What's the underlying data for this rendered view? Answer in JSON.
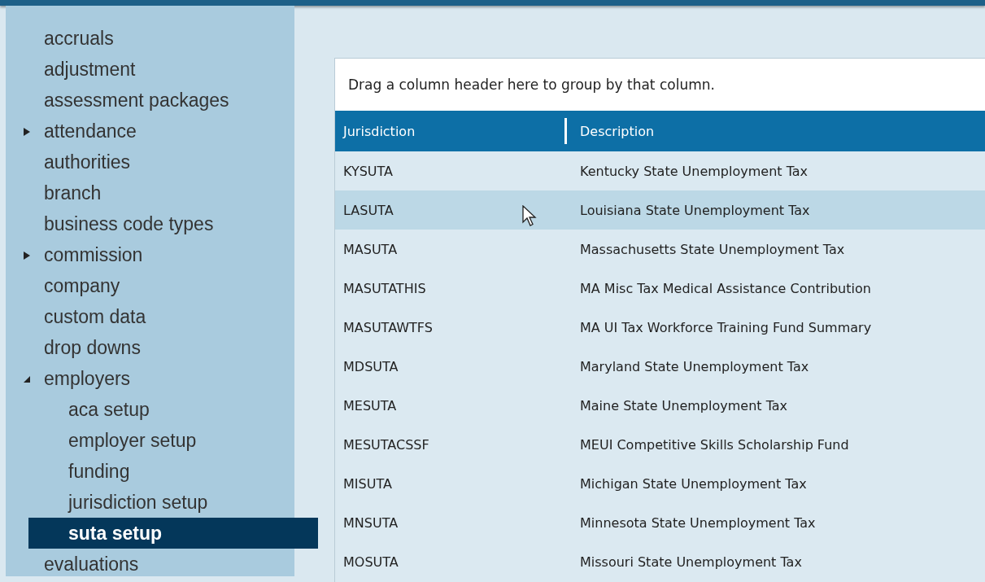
{
  "sidebar": {
    "items": [
      {
        "label": "accruals",
        "kind": "leaf",
        "selected": false
      },
      {
        "label": "adjustment",
        "kind": "leaf",
        "selected": false
      },
      {
        "label": "assessment packages",
        "kind": "leaf",
        "selected": false
      },
      {
        "label": "attendance",
        "kind": "group",
        "expanded": false,
        "selected": false
      },
      {
        "label": "authorities",
        "kind": "leaf",
        "selected": false
      },
      {
        "label": "branch",
        "kind": "leaf",
        "selected": false
      },
      {
        "label": "business code types",
        "kind": "leaf",
        "selected": false
      },
      {
        "label": "commission",
        "kind": "group",
        "expanded": false,
        "selected": false
      },
      {
        "label": "company",
        "kind": "leaf",
        "selected": false
      },
      {
        "label": "custom data",
        "kind": "leaf",
        "selected": false
      },
      {
        "label": "drop downs",
        "kind": "leaf",
        "selected": false
      },
      {
        "label": "employers",
        "kind": "group",
        "expanded": true,
        "selected": false,
        "children": [
          {
            "label": "aca setup",
            "kind": "leaf",
            "selected": false
          },
          {
            "label": "employer setup",
            "kind": "leaf",
            "selected": false
          },
          {
            "label": "funding",
            "kind": "leaf",
            "selected": false
          },
          {
            "label": "jurisdiction setup",
            "kind": "leaf",
            "selected": false
          },
          {
            "label": "suta setup",
            "kind": "leaf",
            "selected": true
          }
        ]
      },
      {
        "label": "evaluations",
        "kind": "leaf",
        "selected": false
      }
    ]
  },
  "grid": {
    "group_panel": "Drag a column header here to group by that column.",
    "columns": [
      "Jurisdiction",
      "Description"
    ],
    "rows": [
      {
        "cells": [
          "KYSUTA",
          "Kentucky State Unemployment Tax"
        ],
        "hovered": false
      },
      {
        "cells": [
          "LASUTA",
          "Louisiana State Unemployment Tax"
        ],
        "hovered": true
      },
      {
        "cells": [
          "MASUTA",
          "Massachusetts State Unemployment Tax"
        ],
        "hovered": false
      },
      {
        "cells": [
          "MASUTATHIS",
          "MA Misc Tax Medical Assistance Contribution"
        ],
        "hovered": false
      },
      {
        "cells": [
          "MASUTAWTFS",
          "MA UI Tax Workforce Training Fund Summary"
        ],
        "hovered": false
      },
      {
        "cells": [
          "MDSUTA",
          "Maryland State Unemployment Tax"
        ],
        "hovered": false
      },
      {
        "cells": [
          "MESUTA",
          "Maine State Unemployment Tax"
        ],
        "hovered": false
      },
      {
        "cells": [
          "MESUTACSSF",
          "MEUI Competitive Skills Scholarship Fund"
        ],
        "hovered": false
      },
      {
        "cells": [
          "MISUTA",
          "Michigan State Unemployment Tax"
        ],
        "hovered": false
      },
      {
        "cells": [
          "MNSUTA",
          "Minnesota State Unemployment Tax"
        ],
        "hovered": false
      },
      {
        "cells": [
          "MOSUTA",
          "Missouri State Unemployment Tax"
        ],
        "hovered": false
      }
    ]
  }
}
